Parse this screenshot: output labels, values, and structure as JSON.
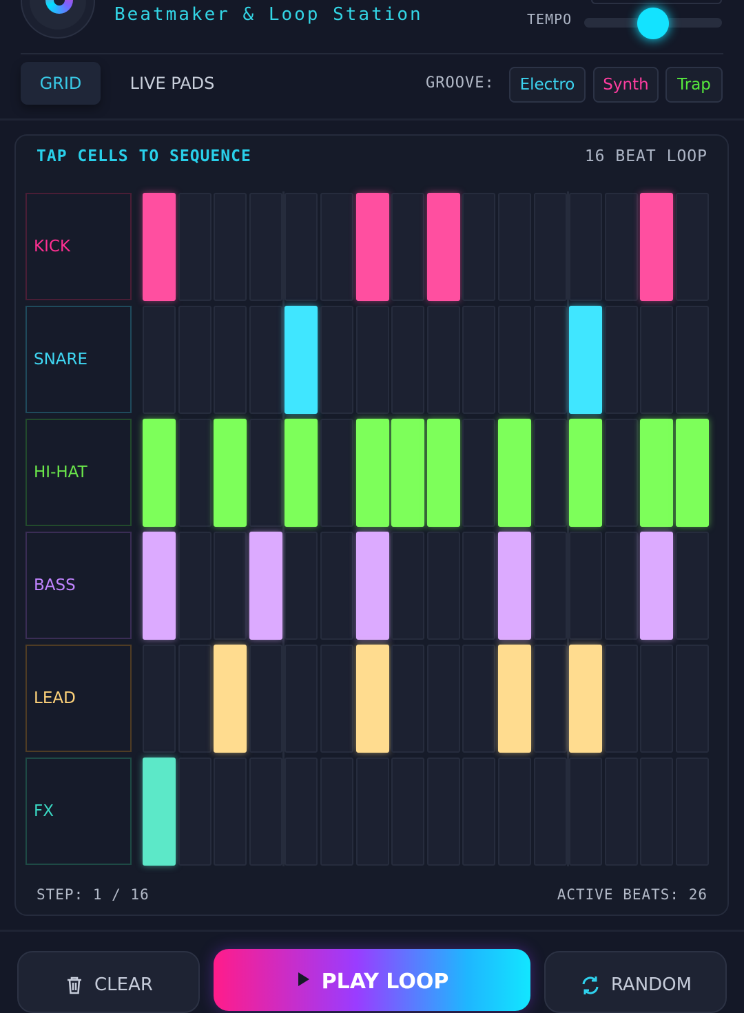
{
  "header": {
    "app_title": "Beatmaker & Loop Station",
    "tempo_label": "TEMPO",
    "tempo_level": 0.5
  },
  "tabs": [
    {
      "label": "GRID",
      "active": true
    },
    {
      "label": "LIVE PADS",
      "active": false
    }
  ],
  "groove": {
    "label": "GROOVE:",
    "options": [
      {
        "label": "Electro",
        "color": "#3cd4f0"
      },
      {
        "label": "Synth",
        "color": "#ff3da0"
      },
      {
        "label": "Trap",
        "color": "#56e83d"
      }
    ]
  },
  "sequencer": {
    "title": "TAP CELLS TO SEQUENCE",
    "loop_label": "16 BEAT LOOP",
    "steps": 16,
    "tracks": [
      {
        "name": "KICK",
        "color": "#ff4fa0",
        "border": "#4a1e36",
        "text_color": "#ff2f92",
        "active": [
          0,
          6,
          8,
          14
        ]
      },
      {
        "name": "SNARE",
        "color": "#40e6ff",
        "border": "#1f4a5c",
        "text_color": "#3fd6f2",
        "active": [
          4,
          12
        ]
      },
      {
        "name": "HI-HAT",
        "color": "#7dff5a",
        "border": "#224a2c",
        "text_color": "#6be84b",
        "active": [
          0,
          2,
          4,
          6,
          7,
          8,
          10,
          12,
          14,
          15
        ]
      },
      {
        "name": "BASS",
        "color": "#dcaaff",
        "border": "#3a2d55",
        "text_color": "#c184ff",
        "active": [
          0,
          3,
          6,
          10,
          14
        ]
      },
      {
        "name": "LEAD",
        "color": "#ffdc8f",
        "border": "#4f3c24",
        "text_color": "#ffd37a",
        "active": [
          2,
          6,
          10,
          12
        ]
      },
      {
        "name": "FX",
        "color": "#5ce8c8",
        "border": "#1e4a45",
        "text_color": "#3ad9c4",
        "active": [
          0
        ]
      }
    ]
  },
  "status": {
    "step": "STEP: 1 / 16",
    "active_beats": "ACTIVE BEATS: 26"
  },
  "controls": {
    "clear_label": "CLEAR",
    "play_label": "PLAY LOOP",
    "random_label": "RANDOM"
  }
}
